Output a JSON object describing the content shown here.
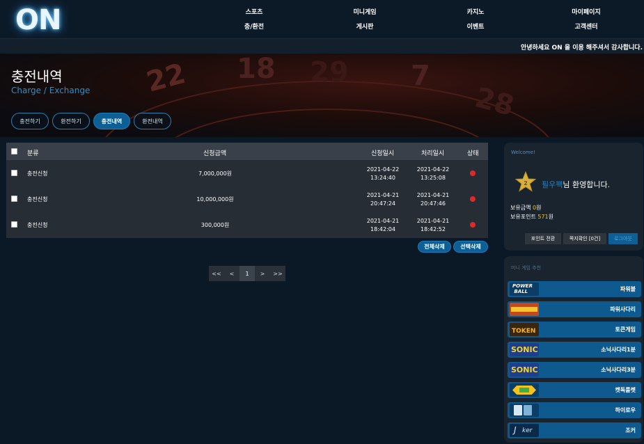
{
  "header": {
    "logo": "ON",
    "nav": [
      {
        "label": "스포츠"
      },
      {
        "label": "미니게임"
      },
      {
        "label": "카지노"
      },
      {
        "label": "마이페이지"
      },
      {
        "label": "충/환전"
      },
      {
        "label": "게시판"
      },
      {
        "label": "이벤트"
      },
      {
        "label": "고객센터"
      }
    ]
  },
  "ticker": "안녕하세요 ON 을 이용 해주셔서 감사합니다.",
  "banner": {
    "title": "충전내역",
    "subtitle": "Charge / Exchange",
    "tabs": [
      {
        "label": "충전하기"
      },
      {
        "label": "환전하기"
      },
      {
        "label": "충전내역"
      },
      {
        "label": "환전내역"
      }
    ]
  },
  "table": {
    "headers": {
      "type": "분류",
      "amount": "신청금액",
      "request_date": "신청일시",
      "process_date": "처리일시",
      "status": "상태"
    },
    "rows": [
      {
        "type": "충전신청",
        "amount": "7,000,000원",
        "req_date": "2021-04-22",
        "req_time": "13:24:40",
        "proc_date": "2021-04-22",
        "proc_time": "13:25:08"
      },
      {
        "type": "충전신청",
        "amount": "10,000,000원",
        "req_date": "2021-04-21",
        "req_time": "20:47:24",
        "proc_date": "2021-04-21",
        "proc_time": "20:47:46"
      },
      {
        "type": "충전신청",
        "amount": "300,000원",
        "req_date": "2021-04-21",
        "req_time": "18:42:04",
        "proc_date": "2021-04-21",
        "proc_time": "18:42:52"
      }
    ],
    "delete_all": "전체삭제",
    "delete_selected": "선택삭제"
  },
  "pagination": {
    "first": "<<",
    "prev": "<",
    "current": "1",
    "next": ">",
    "last": ">>"
  },
  "user_panel": {
    "title": "Welcome!",
    "level": "2",
    "username": "필우팩",
    "greeting": "님 환영합니다.",
    "balance_label": "보유금액",
    "balance_value": "0",
    "balance_unit": "원",
    "points_label": "보유포인트",
    "points_value": "571",
    "points_unit": "원",
    "btn_points": "포인트 전환",
    "btn_messages": "쪽지확인 [0건]",
    "btn_logout": "로그아웃"
  },
  "mini_games": {
    "title": "미니 게임 추천",
    "items": [
      {
        "label": "파워볼",
        "icon": "powerball-logo"
      },
      {
        "label": "파워사다리",
        "icon": "power-ladder-logo"
      },
      {
        "label": "토큰게임",
        "icon": "token-logo"
      },
      {
        "label": "소닉사다리1분",
        "icon": "sonic-logo"
      },
      {
        "label": "소닉사다리3분",
        "icon": "sonic-logo"
      },
      {
        "label": "켓독룰렛",
        "icon": "catdog-roulette-logo"
      },
      {
        "label": "하이로우",
        "icon": "hilow-logo"
      },
      {
        "label": "조커",
        "icon": "joker-logo"
      }
    ]
  },
  "colors": {
    "accent": "#0e5f95",
    "status_red": "#e02a2a",
    "background": "#0b1826"
  }
}
